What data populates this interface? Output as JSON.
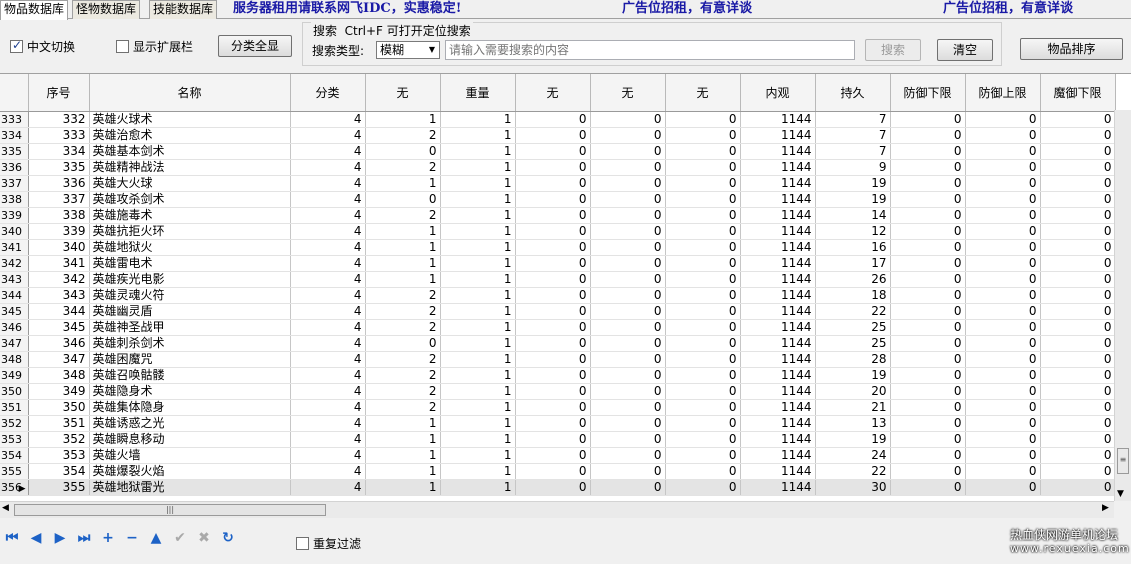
{
  "tabs": [
    "物品数据库",
    "怪物数据库",
    "技能数据库"
  ],
  "banners": [
    "服务器租用请联系网飞IDC，实惠稳定!",
    "广告位招租，有意详谈",
    "广告位招租，有意详谈"
  ],
  "controls": {
    "chinese_toggle": "中文切换",
    "show_extend": "显示扩展栏",
    "category_all": "分类全显",
    "search_title": "搜索  Ctrl+F 可打开定位搜索",
    "search_type_label": "搜索类型:",
    "search_type_value": "模糊",
    "search_placeholder": "请输入需要搜索的内容",
    "search_button": "搜索",
    "clear_button": "清空",
    "sort_button": "物品排序"
  },
  "colors": {
    "banner": "#1a1aa6",
    "nav": "#1d62c6"
  },
  "table": {
    "headers": [
      "序号",
      "名称",
      "分类",
      "无",
      "重量",
      "无",
      "无",
      "无",
      "内观",
      "持久",
      "防御下限",
      "防御上限",
      "魔御下限"
    ],
    "rows": [
      {
        "ind": "333",
        "cells": [
          "332",
          "英雄火球术",
          "4",
          "1",
          "1",
          "0",
          "0",
          "0",
          "1144",
          "7",
          "0",
          "0",
          "0"
        ]
      },
      {
        "ind": "334",
        "cells": [
          "333",
          "英雄治愈术",
          "4",
          "2",
          "1",
          "0",
          "0",
          "0",
          "1144",
          "7",
          "0",
          "0",
          "0"
        ]
      },
      {
        "ind": "335",
        "cells": [
          "334",
          "英雄基本剑术",
          "4",
          "0",
          "1",
          "0",
          "0",
          "0",
          "1144",
          "7",
          "0",
          "0",
          "0"
        ]
      },
      {
        "ind": "336",
        "cells": [
          "335",
          "英雄精神战法",
          "4",
          "2",
          "1",
          "0",
          "0",
          "0",
          "1144",
          "9",
          "0",
          "0",
          "0"
        ]
      },
      {
        "ind": "337",
        "cells": [
          "336",
          "英雄大火球",
          "4",
          "1",
          "1",
          "0",
          "0",
          "0",
          "1144",
          "19",
          "0",
          "0",
          "0"
        ]
      },
      {
        "ind": "338",
        "cells": [
          "337",
          "英雄攻杀剑术",
          "4",
          "0",
          "1",
          "0",
          "0",
          "0",
          "1144",
          "19",
          "0",
          "0",
          "0"
        ]
      },
      {
        "ind": "339",
        "cells": [
          "338",
          "英雄施毒术",
          "4",
          "2",
          "1",
          "0",
          "0",
          "0",
          "1144",
          "14",
          "0",
          "0",
          "0"
        ]
      },
      {
        "ind": "340",
        "cells": [
          "339",
          "英雄抗拒火环",
          "4",
          "1",
          "1",
          "0",
          "0",
          "0",
          "1144",
          "12",
          "0",
          "0",
          "0"
        ]
      },
      {
        "ind": "341",
        "cells": [
          "340",
          "英雄地狱火",
          "4",
          "1",
          "1",
          "0",
          "0",
          "0",
          "1144",
          "16",
          "0",
          "0",
          "0"
        ]
      },
      {
        "ind": "342",
        "cells": [
          "341",
          "英雄雷电术",
          "4",
          "1",
          "1",
          "0",
          "0",
          "0",
          "1144",
          "17",
          "0",
          "0",
          "0"
        ]
      },
      {
        "ind": "343",
        "cells": [
          "342",
          "英雄疾光电影",
          "4",
          "1",
          "1",
          "0",
          "0",
          "0",
          "1144",
          "26",
          "0",
          "0",
          "0"
        ]
      },
      {
        "ind": "344",
        "cells": [
          "343",
          "英雄灵魂火符",
          "4",
          "2",
          "1",
          "0",
          "0",
          "0",
          "1144",
          "18",
          "0",
          "0",
          "0"
        ]
      },
      {
        "ind": "345",
        "cells": [
          "344",
          "英雄幽灵盾",
          "4",
          "2",
          "1",
          "0",
          "0",
          "0",
          "1144",
          "22",
          "0",
          "0",
          "0"
        ]
      },
      {
        "ind": "346",
        "cells": [
          "345",
          "英雄神圣战甲",
          "4",
          "2",
          "1",
          "0",
          "0",
          "0",
          "1144",
          "25",
          "0",
          "0",
          "0"
        ]
      },
      {
        "ind": "347",
        "cells": [
          "346",
          "英雄刺杀剑术",
          "4",
          "0",
          "1",
          "0",
          "0",
          "0",
          "1144",
          "25",
          "0",
          "0",
          "0"
        ]
      },
      {
        "ind": "348",
        "cells": [
          "347",
          "英雄困魔咒",
          "4",
          "2",
          "1",
          "0",
          "0",
          "0",
          "1144",
          "28",
          "0",
          "0",
          "0"
        ]
      },
      {
        "ind": "349",
        "cells": [
          "348",
          "英雄召唤骷髅",
          "4",
          "2",
          "1",
          "0",
          "0",
          "0",
          "1144",
          "19",
          "0",
          "0",
          "0"
        ]
      },
      {
        "ind": "350",
        "cells": [
          "349",
          "英雄隐身术",
          "4",
          "2",
          "1",
          "0",
          "0",
          "0",
          "1144",
          "20",
          "0",
          "0",
          "0"
        ]
      },
      {
        "ind": "351",
        "cells": [
          "350",
          "英雄集体隐身",
          "4",
          "2",
          "1",
          "0",
          "0",
          "0",
          "1144",
          "21",
          "0",
          "0",
          "0"
        ]
      },
      {
        "ind": "352",
        "cells": [
          "351",
          "英雄诱惑之光",
          "4",
          "1",
          "1",
          "0",
          "0",
          "0",
          "1144",
          "13",
          "0",
          "0",
          "0"
        ]
      },
      {
        "ind": "353",
        "cells": [
          "352",
          "英雄瞬息移动",
          "4",
          "1",
          "1",
          "0",
          "0",
          "0",
          "1144",
          "19",
          "0",
          "0",
          "0"
        ]
      },
      {
        "ind": "354",
        "cells": [
          "353",
          "英雄火墙",
          "4",
          "1",
          "1",
          "0",
          "0",
          "0",
          "1144",
          "24",
          "0",
          "0",
          "0"
        ]
      },
      {
        "ind": "355",
        "cells": [
          "354",
          "英雄爆裂火焰",
          "4",
          "1",
          "1",
          "0",
          "0",
          "0",
          "1144",
          "22",
          "0",
          "0",
          "0"
        ]
      },
      {
        "ind": "356",
        "cells": [
          "355",
          "英雄地狱雷光",
          "4",
          "1",
          "1",
          "0",
          "0",
          "0",
          "1144",
          "30",
          "0",
          "0",
          "0"
        ]
      }
    ],
    "selected_index": 23
  },
  "navigator": {
    "icons": [
      "first-icon",
      "prior-icon",
      "next-icon",
      "last-icon",
      "insert-icon",
      "delete-icon",
      "edit-icon",
      "post-icon",
      "cancel-icon",
      "refresh-icon"
    ],
    "glyphs": [
      "⏮",
      "◀",
      "▶",
      "⏭",
      "+",
      "−",
      "▲",
      "✔",
      "✖",
      "↻"
    ]
  },
  "repeat_filter": "重复过滤",
  "watermark": {
    "line1": "热血侠网游单机论坛",
    "line2": "www.rexuexia.com"
  }
}
